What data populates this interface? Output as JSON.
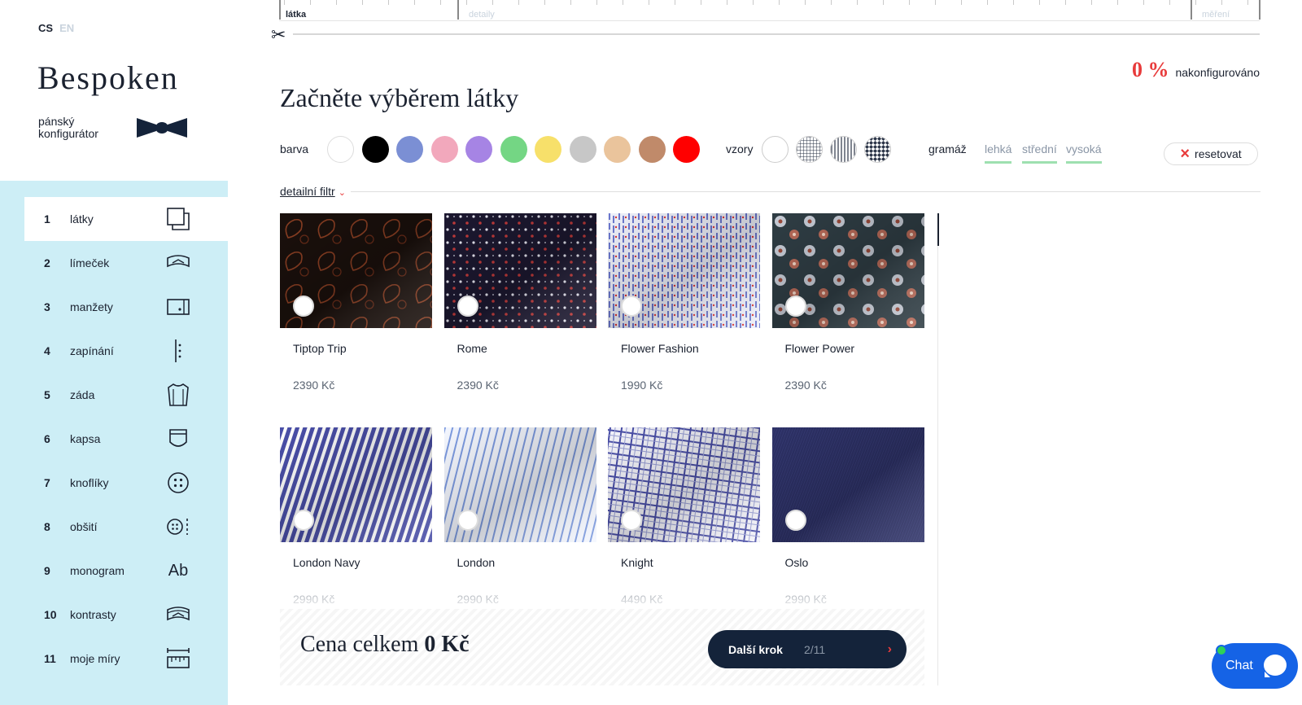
{
  "languages": [
    {
      "code": "CS",
      "active": true
    },
    {
      "code": "EN",
      "active": false
    }
  ],
  "brand": {
    "name": "Bespoken",
    "tagline_line1": "pánský",
    "tagline_line2": "konfigurátor"
  },
  "progress_bar": {
    "steps": [
      {
        "label": "látka",
        "active": true
      },
      {
        "label": "detaily",
        "active": false
      },
      {
        "label": "měření",
        "active": false
      }
    ]
  },
  "progress": {
    "value": "0 %",
    "label": "nakonfigurováno"
  },
  "heading": "Začněte výběrem látky",
  "filters": {
    "color_label": "barva",
    "colors": [
      "#ffffff",
      "#000000",
      "#7b8fd4",
      "#f2a8bc",
      "#a684e4",
      "#74d684",
      "#f7e06a",
      "#c7c7c7",
      "#eac49c",
      "#c08a6a",
      "#ff0000"
    ],
    "pattern_label": "vzory",
    "patterns": [
      "plain",
      "check",
      "stripe",
      "diamond"
    ],
    "weight_label": "gramáž",
    "weights": [
      "lehká",
      "střední",
      "vysoká"
    ],
    "reset_label": "resetovat",
    "detail_label": "detailní filtr"
  },
  "sidebar": {
    "items": [
      {
        "num": "1",
        "label": "látky",
        "icon": "fabric-icon"
      },
      {
        "num": "2",
        "label": "límeček",
        "icon": "collar-icon"
      },
      {
        "num": "3",
        "label": "manžety",
        "icon": "cuff-icon"
      },
      {
        "num": "4",
        "label": "zapínání",
        "icon": "placket-icon"
      },
      {
        "num": "5",
        "label": "záda",
        "icon": "back-icon"
      },
      {
        "num": "6",
        "label": "kapsa",
        "icon": "pocket-icon"
      },
      {
        "num": "7",
        "label": "knoflíky",
        "icon": "buttons-icon"
      },
      {
        "num": "8",
        "label": "obšití",
        "icon": "stitching-icon"
      },
      {
        "num": "9",
        "label": "monogram",
        "icon": "monogram-icon",
        "glyph": "Ab"
      },
      {
        "num": "10",
        "label": "kontrasty",
        "icon": "contrast-icon"
      },
      {
        "num": "11",
        "label": "moje míry",
        "icon": "measure-icon"
      }
    ]
  },
  "fabrics": [
    {
      "name": "Tiptop Trip",
      "price": "2390 Kč",
      "pattern": "paisley"
    },
    {
      "name": "Rome",
      "price": "2390 Kč",
      "pattern": "dots"
    },
    {
      "name": "Flower Fashion",
      "price": "1990 Kč",
      "pattern": "blueflower"
    },
    {
      "name": "Flower Power",
      "price": "2390 Kč",
      "pattern": "floral"
    },
    {
      "name": "London Navy",
      "price": "2990 Kč",
      "pattern": "navystripe"
    },
    {
      "name": "London",
      "price": "2990 Kč",
      "pattern": "lightstripe"
    },
    {
      "name": "Knight",
      "price": "4490 Kč",
      "pattern": "check"
    },
    {
      "name": "Oslo",
      "price": "2990 Kč",
      "pattern": "navy"
    }
  ],
  "footer": {
    "total_label": "Cena celkem",
    "total_value": "0 Kč",
    "next_label": "Další krok",
    "next_count": "2/11"
  },
  "chat": {
    "label": "Chat"
  }
}
